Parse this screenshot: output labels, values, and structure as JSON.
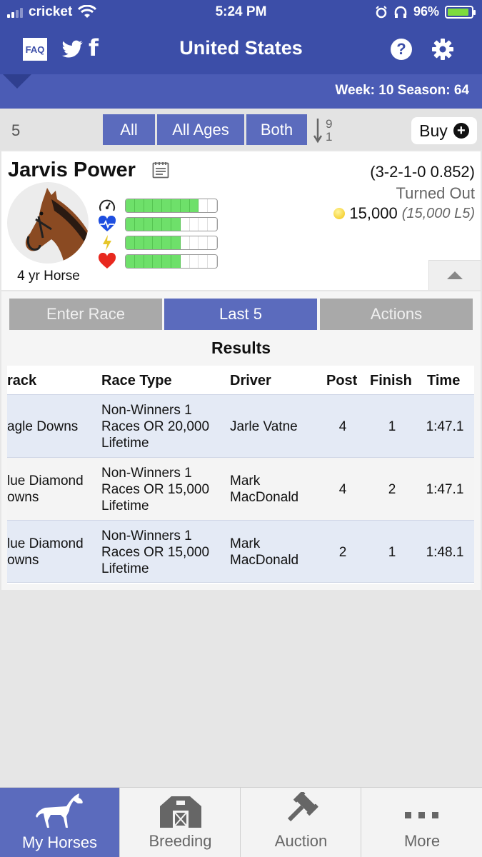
{
  "status_bar": {
    "carrier": "cricket",
    "time": "5:24 PM",
    "battery": "96%"
  },
  "header": {
    "faq_label": "FAQ",
    "title": "United States",
    "help_symbol": "?",
    "facebook_symbol": "f"
  },
  "season_bar": {
    "week_text": "Week: 10",
    "season_text": "Season: 64"
  },
  "filters": {
    "count": "5",
    "all_label": "All",
    "ages_label": "All Ages",
    "both_label": "Both",
    "sort_top": "9",
    "sort_bottom": "1",
    "buy_label": "Buy"
  },
  "horse": {
    "name": "Jarvis Power",
    "record": "(3-2-1-0 0.852)",
    "status": "Turned Out",
    "earnings": "15,000",
    "earnings_l5": "(15,000 L5)",
    "age_label": "4 yr Horse",
    "stats": [
      {
        "icon": "speedometer-icon",
        "level": 0.75
      },
      {
        "icon": "heartbeat-icon",
        "level": 0.55
      },
      {
        "icon": "lightning-icon",
        "level": 0.62
      },
      {
        "icon": "heart-icon",
        "level": 0.62
      }
    ]
  },
  "tabs": {
    "enter_race": "Enter Race",
    "last5": "Last 5",
    "actions": "Actions"
  },
  "results": {
    "title": "Results",
    "headers": {
      "track": "rack",
      "race_type": "Race Type",
      "driver": "Driver",
      "post": "Post",
      "finish": "Finish",
      "time": "Time"
    },
    "rows": [
      {
        "track": [
          "agle Downs"
        ],
        "race_type": [
          "Non-Winners 1",
          "Races OR 20,000",
          "Lifetime"
        ],
        "driver": [
          "Jarle Vatne"
        ],
        "post": "4",
        "finish": "1",
        "time": "1:47.1"
      },
      {
        "track": [
          "lue Diamond",
          "owns"
        ],
        "race_type": [
          "Non-Winners 1",
          "Races OR 15,000",
          "Lifetime"
        ],
        "driver": [
          "Mark",
          "MacDonald"
        ],
        "post": "4",
        "finish": "2",
        "time": "1:47.1"
      },
      {
        "track": [
          "lue Diamond",
          "owns"
        ],
        "race_type": [
          "Non-Winners 1",
          "Races OR 15,000",
          "Lifetime"
        ],
        "driver": [
          "Mark",
          "MacDonald"
        ],
        "post": "2",
        "finish": "1",
        "time": "1:48.1"
      }
    ]
  },
  "tabbar": {
    "my_horses": "My Horses",
    "breeding": "Breeding",
    "auction": "Auction",
    "more": "More"
  },
  "colors": {
    "primary": "#3c4ea8",
    "accent": "#5b6bbd",
    "bar_green": "#6ee06a",
    "row_alt": "#e4eaf5"
  }
}
